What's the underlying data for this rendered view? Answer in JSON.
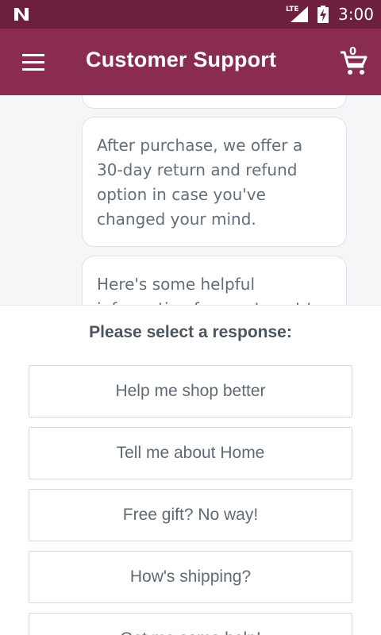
{
  "status_bar": {
    "network_label": "LTE",
    "time": "3:00",
    "icons": [
      "n-logo-icon",
      "signal-icon",
      "battery-charging-icon"
    ]
  },
  "app_bar": {
    "title": "Customer Support",
    "menu_icon": "hamburger-menu-icon",
    "cart_icon": "shopping-cart-icon",
    "cart_count": "0",
    "color": "#8a2b51"
  },
  "chat": {
    "messages": [
      {
        "text": ""
      },
      {
        "text": "After purchase, we offer a 30-day return and refund option in case you've changed your mind."
      },
      {
        "text": "Here's some helpful information for you to get to"
      }
    ]
  },
  "responses": {
    "prompt": "Please select a response:",
    "options": [
      {
        "label": "Help me shop better"
      },
      {
        "label": "Tell me about Home"
      },
      {
        "label": "Free gift? No way!"
      },
      {
        "label": "How's shipping?"
      },
      {
        "label": "Get me some help!"
      }
    ]
  }
}
